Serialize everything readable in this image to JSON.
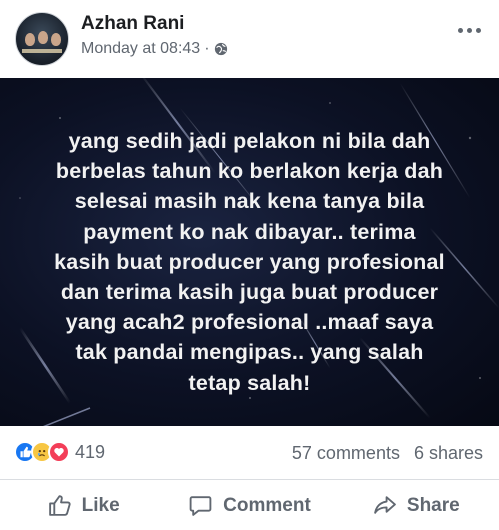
{
  "post": {
    "author": "Azhan Rani",
    "timestamp": "Monday at 08:43",
    "separator": "·",
    "privacy_icon": "globe-icon",
    "menu_icon": "more-options-icon"
  },
  "image_text": {
    "lines": [
      "yang sedih jadi pelakon ni bila dah",
      "berbelas tahun ko berlakon kerja dah",
      "selesai masih nak kena tanya bila",
      "payment ko nak dibayar.. terima",
      "kasih buat producer yang profesional",
      "dan terima kasih juga buat producer",
      "yang acah2 profesional ..maaf saya",
      "tak pandai mengipas.. yang salah",
      "tetap salah!"
    ]
  },
  "stats": {
    "reaction_icons": [
      "like-reaction-icon",
      "sad-reaction-icon",
      "love-reaction-icon"
    ],
    "reaction_count": "419",
    "comments": "57 comments",
    "shares": "6 shares"
  },
  "actions": {
    "like": "Like",
    "comment": "Comment",
    "share": "Share"
  },
  "colors": {
    "facebook_blue": "#1877f2",
    "text_secondary": "#606770",
    "image_background": "#0c1124"
  }
}
